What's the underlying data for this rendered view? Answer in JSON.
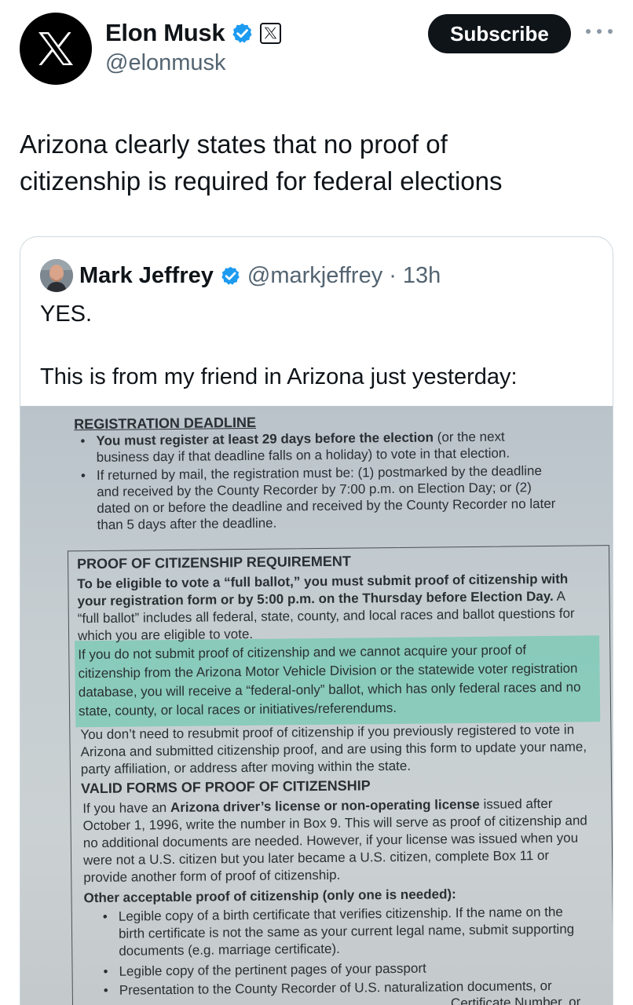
{
  "author": {
    "name": "Elon Musk",
    "handle": "@elonmusk",
    "subscribe_label": "Subscribe"
  },
  "tweet": {
    "text_line1": "Arizona clearly states that no proof of",
    "text_line2": "citizenship is required for federal elections"
  },
  "quote": {
    "name": "Mark Jeffrey",
    "handle": "@markjeffrey",
    "separator": "·",
    "time": "13h",
    "line1": "YES.",
    "line2": "This is from my friend in Arizona just yesterday:"
  },
  "document": {
    "reg_heading": "REGISTRATION DEADLINE",
    "reg_b1_l1a": "You must register at least 29 days before the election",
    "reg_b1_l1b": "(or the next",
    "reg_b1_l2": "business day if that deadline falls on a holiday) to vote in that election.",
    "reg_b2_l1": "If returned by mail, the registration must be: (1) postmarked by the deadline",
    "reg_b2_l2": "and received by the County Recorder by 7:00 p.m. on Election Day; or (2)",
    "reg_b2_l3": "dated on or before the deadline and received by the County Recorder no later",
    "reg_b2_l4": "than 5 days after the deadline.",
    "poc_heading": "PROOF OF CITIZENSHIP REQUIREMENT",
    "poc_l1": "To be eligible to vote a “full ballot,” you must submit proof of citizenship with",
    "poc_l2a": "your registration form or by 5:00 p.m. on the Thursday before Election Day.",
    "poc_l2b": "A",
    "poc_l3": "“full ballot” includes all federal, state, county, and local races and ballot questions for",
    "poc_l4": "which you are eligible to vote.",
    "hl_l1": "If you do not submit proof of citizenship and we cannot acquire your proof of",
    "hl_l2": "citizenship from the Arizona Motor Vehicle Division or the statewide voter registration",
    "hl_l3": "database, you will receive a “federal-only” ballot, which has only federal races and no",
    "hl_l4": "state, county, or local races or initiatives/referendums.",
    "resub_l1": "You don’t need to resubmit proof of citizenship if you previously registered to vote in",
    "resub_l2": "Arizona and submitted citizenship proof, and are using this form to update your name,",
    "resub_l3": "party affiliation, or address after moving within the state.",
    "valid_heading": "VALID FORMS OF PROOF OF CITIZENSHIP",
    "valid_l1a": "If you have an",
    "valid_l1b": "Arizona driver’s license or non-operating license",
    "valid_l1c": "issued after",
    "valid_l2": "October 1, 1996, write the number in Box 9. This will serve as proof of citizenship and",
    "valid_l3": "no additional documents are needed. However, if your license was issued when you",
    "valid_l4": "were not a U.S. citizen but you later became a U.S. citizen, complete Box 11 or",
    "valid_l5": "provide another form of proof of citizenship.",
    "other_heading": "Other acceptable proof of citizenship (only one is needed):",
    "other_b1_l1": "Legible copy of a birth certificate that verifies citizenship. If the name on the",
    "other_b1_l2": "birth certificate is not the same as your current legal name, submit supporting",
    "other_b1_l3": "documents (e.g. marriage certificate).",
    "other_b2_l1": "Legible copy of the pertinent pages of your passport",
    "other_b3_l1": "Presentation to the County Recorder of U.S. naturalization documents, or",
    "other_b3_l2": "Certificate Number, or"
  },
  "icons": {
    "verified_color": "#1d9bf0",
    "x_logo": "x-logo-icon",
    "more": "more-icon"
  }
}
